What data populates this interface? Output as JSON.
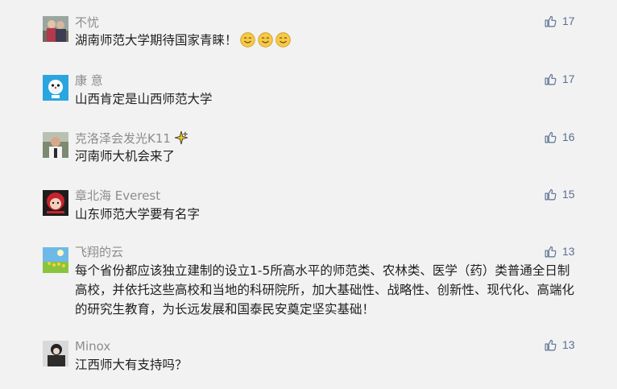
{
  "comments": [
    {
      "name": "不忧",
      "text": "湖南师范大学期待国家青睐！",
      "likes": "17",
      "emoji_count": 3
    },
    {
      "name": "康 意",
      "text": "山西肯定是山西师范大学",
      "likes": "17"
    },
    {
      "name": "克洛泽会发光K11",
      "text": "河南师大机会来了",
      "likes": "16"
    },
    {
      "name": "章北海 Everest",
      "text": "山东师范大学要有名字",
      "likes": "15"
    },
    {
      "name": "飞翔的云",
      "text": "每个省份都应该独立建制的设立1-5所高水平的师范类、农林类、医学（药）类普通全日制高校，并依托这些高校和当地的科研院所，加大基础性、战略性、创新性、现代化、高端化的研究生教育，为长远发展和国泰民安奠定坚实基础！",
      "likes": "13"
    },
    {
      "name": "Minox",
      "text": "江西师大有支持吗？",
      "likes": "13"
    }
  ],
  "icons": {
    "like": "thumbs-up-icon",
    "emoji": "smile-emoji-icon",
    "badge": "sparkle-icon"
  },
  "colors": {
    "background": "#f2f2f2",
    "name": "#8c8c8c",
    "text": "#1f1f1f",
    "like": "#5b6f93"
  }
}
